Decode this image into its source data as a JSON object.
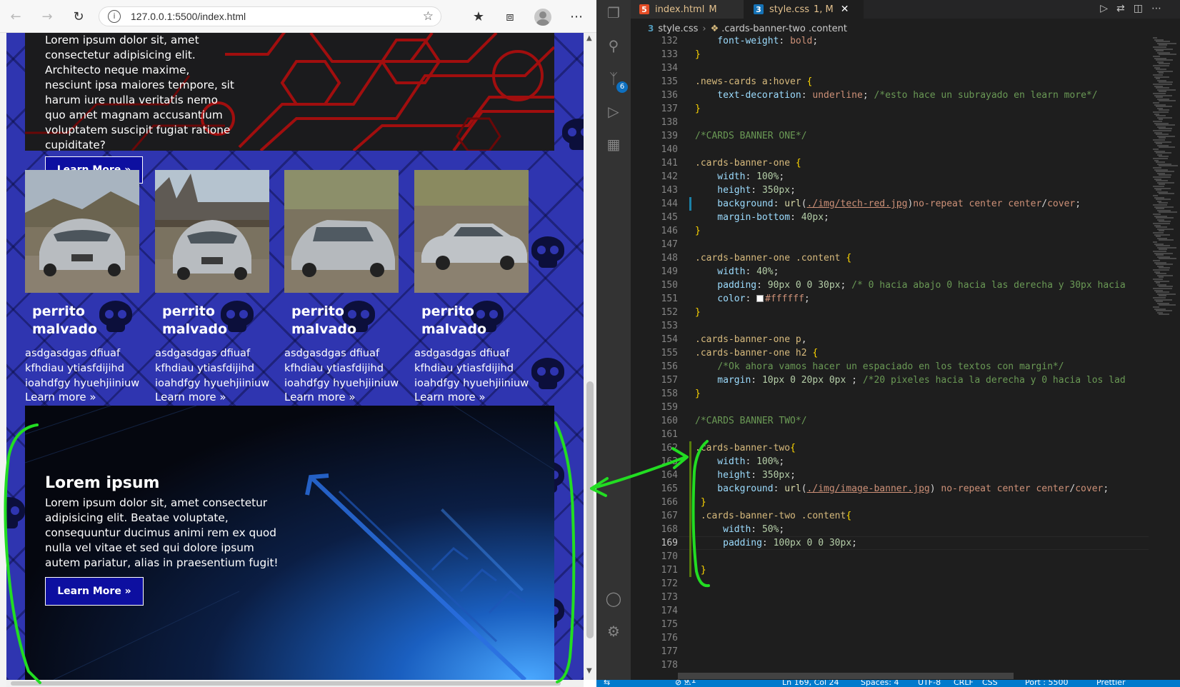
{
  "browser": {
    "url": "127.0.0.1:5500/index.html",
    "banner_one": {
      "text": "Lorem ipsum dolor sit, amet consectetur adipisicing elit. Architecto neque maxime, nesciunt ipsa maiores tempore, sit harum iure nulla veritatis nemo quo amet magnam accusantium voluptatem suscipit fugiat ratione cupiditate?",
      "button_label": "Learn More »"
    },
    "cards": [
      {
        "title": "perrito malvado",
        "body": [
          "asdgasdgas dfiuaf",
          "kfhdiau ytiasfdijihd",
          "ioahdfgy hyuehjiiniuw"
        ],
        "link": "Learn more »"
      },
      {
        "title": "perrito malvado",
        "body": [
          "asdgasdgas dfiuaf",
          "kfhdiau ytiasfdijihd",
          "ioahdfgy hyuehjiiniuw"
        ],
        "link": "Learn more »"
      },
      {
        "title": "perrito malvado",
        "body": [
          "asdgasdgas dfiuaf",
          "kfhdiau ytiasfdijihd",
          "ioahdfgy hyuehjiiniuw"
        ],
        "link": "Learn more »"
      },
      {
        "title": "perrito malvado",
        "body": [
          "asdgasdgas dfiuaf",
          "kfhdiau ytiasfdijihd",
          "ioahdfgy hyuehjiiniuw"
        ],
        "link": "Learn more »"
      }
    ],
    "banner_two": {
      "title": "Lorem ipsum",
      "text": "Lorem ipsum dolor sit, amet consectetur adipisicing elit. Beatae voluptate, consequuntur ducimus animi rem ex quod nulla vel vitae et sed qui dolore ipsum autem pariatur, alias in praesentium fugit!",
      "button_label": "Learn More »"
    }
  },
  "vscode": {
    "tabs": [
      {
        "name": "index.html",
        "status": "M",
        "icon": "html5-icon"
      },
      {
        "name": "style.css",
        "status": "1, M",
        "icon": "css3-icon"
      }
    ],
    "breadcrumb": [
      "style.css",
      ".cards-banner-two .content"
    ],
    "scm_badge": "6",
    "colors": {
      "accent": "#007acc",
      "annotation": "#22dd22"
    },
    "lines": [
      {
        "n": 132,
        "tokens": [
          [
            "    font-weight",
            "prop"
          ],
          [
            ": ",
            "op"
          ],
          [
            "bold",
            "val"
          ],
          [
            ";",
            "op"
          ]
        ]
      },
      {
        "n": 133,
        "tokens": [
          [
            "}",
            "br"
          ]
        ]
      },
      {
        "n": 134,
        "tokens": []
      },
      {
        "n": 135,
        "tokens": [
          [
            ".news-cards a:hover ",
            "sel"
          ],
          [
            "{",
            "br"
          ]
        ]
      },
      {
        "n": 136,
        "tokens": [
          [
            "    text-decoration",
            "prop"
          ],
          [
            ": ",
            "op"
          ],
          [
            "underline",
            "val"
          ],
          [
            "; ",
            "op"
          ],
          [
            "/*esto hace un subrayado en learn more*/",
            "cmt"
          ]
        ]
      },
      {
        "n": 137,
        "tokens": [
          [
            "}",
            "br"
          ]
        ]
      },
      {
        "n": 138,
        "tokens": []
      },
      {
        "n": 139,
        "tokens": [
          [
            "/*CARDS BANNER ONE*/",
            "cmt"
          ]
        ]
      },
      {
        "n": 140,
        "tokens": []
      },
      {
        "n": 141,
        "tokens": [
          [
            ".cards-banner-one ",
            "sel"
          ],
          [
            "{",
            "br"
          ]
        ]
      },
      {
        "n": 142,
        "tokens": [
          [
            "    width",
            "prop"
          ],
          [
            ": ",
            "op"
          ],
          [
            "100%",
            "num"
          ],
          [
            ";",
            "op"
          ]
        ]
      },
      {
        "n": 143,
        "tokens": [
          [
            "    height",
            "prop"
          ],
          [
            ": ",
            "op"
          ],
          [
            "350px",
            "num"
          ],
          [
            ";",
            "op"
          ]
        ]
      },
      {
        "n": 144,
        "tokens": [
          [
            "    background",
            "prop"
          ],
          [
            ": ",
            "op"
          ],
          [
            "url",
            "fn"
          ],
          [
            "(",
            "op"
          ],
          [
            "./img/tech-red.jpg",
            "url"
          ],
          [
            ")",
            "op"
          ],
          [
            "no-repeat center center",
            "val"
          ],
          [
            "/",
            "op"
          ],
          [
            "cover",
            "val"
          ],
          [
            ";",
            "op"
          ]
        ]
      },
      {
        "n": 145,
        "tokens": [
          [
            "    margin-bottom",
            "prop"
          ],
          [
            ": ",
            "op"
          ],
          [
            "40px",
            "num"
          ],
          [
            ";",
            "op"
          ]
        ]
      },
      {
        "n": 146,
        "tokens": [
          [
            "}",
            "br"
          ]
        ]
      },
      {
        "n": 147,
        "tokens": []
      },
      {
        "n": 148,
        "tokens": [
          [
            ".cards-banner-one .content ",
            "sel"
          ],
          [
            "{",
            "br"
          ]
        ]
      },
      {
        "n": 149,
        "tokens": [
          [
            "    width",
            "prop"
          ],
          [
            ": ",
            "op"
          ],
          [
            "40%",
            "num"
          ],
          [
            ";",
            "op"
          ]
        ]
      },
      {
        "n": 150,
        "tokens": [
          [
            "    padding",
            "prop"
          ],
          [
            ": ",
            "op"
          ],
          [
            "90px 0 0 30px",
            "num"
          ],
          [
            "; ",
            "op"
          ],
          [
            "/* 0 hacia abajo 0 hacia las derecha y 30px hacia",
            "cmt"
          ]
        ]
      },
      {
        "n": 151,
        "tokens": [
          [
            "    color",
            "prop"
          ],
          [
            ": ",
            "op"
          ],
          [
            "SWATCH",
            "swatch"
          ],
          [
            "#ffffff",
            "val"
          ],
          [
            ";",
            "op"
          ]
        ]
      },
      {
        "n": 152,
        "tokens": [
          [
            "}",
            "br"
          ]
        ]
      },
      {
        "n": 153,
        "tokens": []
      },
      {
        "n": 154,
        "tokens": [
          [
            ".cards-banner-one p",
            "sel"
          ],
          [
            ",",
            "op"
          ]
        ]
      },
      {
        "n": 155,
        "tokens": [
          [
            ".cards-banner-one h2 ",
            "sel"
          ],
          [
            "{",
            "br"
          ]
        ]
      },
      {
        "n": 156,
        "tokens": [
          [
            "    ",
            "op"
          ],
          [
            "/*Ok ahora vamos hacer un espaciado en los textos con margin*/",
            "cmt"
          ]
        ]
      },
      {
        "n": 157,
        "tokens": [
          [
            "    margin",
            "prop"
          ],
          [
            ": ",
            "op"
          ],
          [
            "10px 0 20px 0px",
            "num"
          ],
          [
            " ; ",
            "op"
          ],
          [
            "/*20 pixeles hacia la derecha y 0 hacia los lad",
            "cmt"
          ]
        ]
      },
      {
        "n": 158,
        "tokens": [
          [
            "}",
            "br"
          ]
        ]
      },
      {
        "n": 159,
        "tokens": []
      },
      {
        "n": 160,
        "tokens": [
          [
            "/*CARDS BANNER TWO*/",
            "cmt"
          ]
        ]
      },
      {
        "n": 161,
        "tokens": []
      },
      {
        "n": 162,
        "tokens": [
          [
            ".cards-banner-two",
            "sel"
          ],
          [
            "{",
            "br"
          ]
        ]
      },
      {
        "n": 163,
        "tokens": [
          [
            "    width",
            "prop"
          ],
          [
            ": ",
            "op"
          ],
          [
            "100%",
            "num"
          ],
          [
            ";",
            "op"
          ]
        ]
      },
      {
        "n": 164,
        "tokens": [
          [
            "    height",
            "prop"
          ],
          [
            ": ",
            "op"
          ],
          [
            "350px",
            "num"
          ],
          [
            ";",
            "op"
          ]
        ]
      },
      {
        "n": 165,
        "tokens": [
          [
            "    background",
            "prop"
          ],
          [
            ": ",
            "op"
          ],
          [
            "url",
            "fn"
          ],
          [
            "(",
            "op"
          ],
          [
            "./img/image-banner.jpg",
            "url"
          ],
          [
            ") ",
            "op"
          ],
          [
            "no-repeat center center",
            "val"
          ],
          [
            "/",
            "op"
          ],
          [
            "cover",
            "val"
          ],
          [
            ";",
            "op"
          ]
        ]
      },
      {
        "n": 166,
        "tokens": [
          [
            " }",
            "br"
          ]
        ]
      },
      {
        "n": 167,
        "tokens": [
          [
            " .cards-banner-two .content",
            "sel"
          ],
          [
            "{",
            "br"
          ]
        ]
      },
      {
        "n": 168,
        "tokens": [
          [
            "     width",
            "prop"
          ],
          [
            ": ",
            "op"
          ],
          [
            "50%",
            "num"
          ],
          [
            ";",
            "op"
          ]
        ]
      },
      {
        "n": 169,
        "tokens": [
          [
            "     padding",
            "prop"
          ],
          [
            ": ",
            "op"
          ],
          [
            "100px 0 0 30px",
            "num"
          ],
          [
            ";",
            "op"
          ]
        ]
      },
      {
        "n": 170,
        "tokens": []
      },
      {
        "n": 171,
        "tokens": [
          [
            " }",
            "br"
          ]
        ]
      },
      {
        "n": 172,
        "tokens": []
      },
      {
        "n": 173,
        "tokens": []
      },
      {
        "n": 174,
        "tokens": []
      },
      {
        "n": 175,
        "tokens": []
      },
      {
        "n": 176,
        "tokens": []
      },
      {
        "n": 177,
        "tokens": []
      },
      {
        "n": 178,
        "tokens": []
      }
    ],
    "current_line": 169,
    "statusbar": {
      "position": "Ln 169, Col 24",
      "spaces": "Spaces: 4",
      "encoding": "UTF-8",
      "eol": "CRLF",
      "language": "CSS",
      "port": "Port : 5500",
      "prettier": "Prettier",
      "errors": "0",
      "warnings": "1"
    }
  }
}
